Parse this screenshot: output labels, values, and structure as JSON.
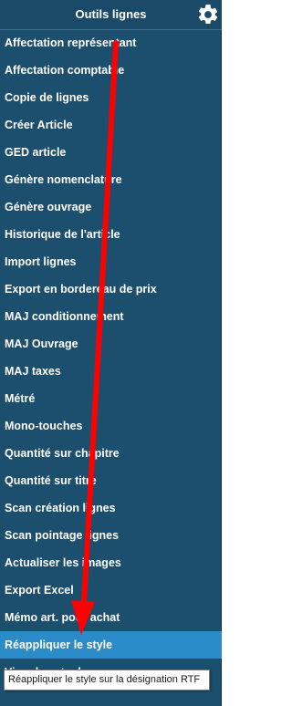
{
  "header": {
    "title": "Outils lignes",
    "settings_icon": "gear-icon"
  },
  "menu": {
    "items": [
      "Affectation représentant",
      "Affectation comptable",
      "Copie de lignes",
      "Créer Article",
      "GED article",
      "Génère nomenclature",
      "Génère ouvrage",
      "Historique de l'article",
      "Import lignes",
      "Export en bordereau de prix",
      "MAJ conditionnement",
      "MAJ Ouvrage",
      "MAJ taxes",
      "Métré",
      "Mono-touches",
      "Quantité sur chapitre",
      "Quantité sur titre",
      "Scan création lignes",
      "Scan pointage lignes",
      "Actualiser les images",
      "Export Excel",
      "Mémo art. pour achat",
      "Réappliquer le style",
      "Visu des stocks"
    ],
    "active_index": 22
  },
  "tooltip": {
    "text": "Réappliquer le style sur la désignation RTF"
  },
  "colors": {
    "panel_bg": "#1c4e6d",
    "active_bg": "#2b8bc9",
    "annotation_arrow": "#ff0000"
  }
}
